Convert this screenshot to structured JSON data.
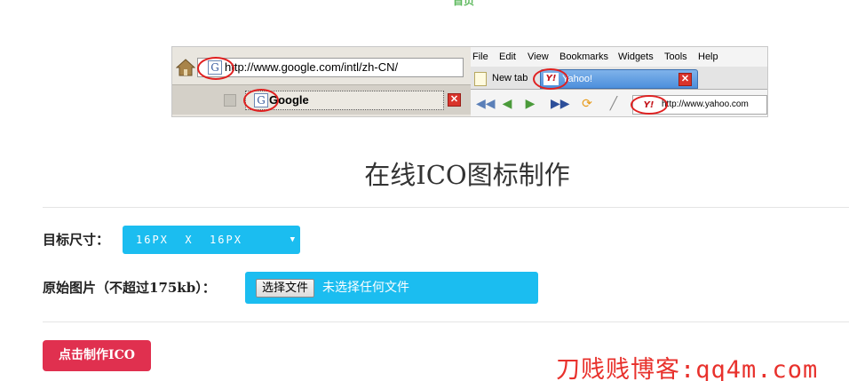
{
  "nav": {
    "home_label": "首页"
  },
  "banner": {
    "left_url": "http://www.google.com/intl/zh-CN/",
    "google_tab_title": "Google",
    "favicon_letter": "G",
    "close_glyph": "✕",
    "menu": [
      "File",
      "Edit",
      "View",
      "Bookmarks",
      "Widgets",
      "Tools",
      "Help"
    ],
    "new_tab_label": "New tab",
    "yahoo_tab_title": "Yahoo!",
    "yahoo_fav": "Y!",
    "yahoo_url": "http://www.yahoo.com",
    "highlight_color": "#e02020"
  },
  "page": {
    "title": "在线ICO图标制作"
  },
  "form": {
    "size_label": "目标尺寸：",
    "size_value": "16PX  X  16PX",
    "source_label": "原始图片（不超过175kb）：",
    "file_button": "选择文件",
    "file_status": "未选择任何文件",
    "submit_label": "点击制作ICO",
    "accent_color": "#1bbdf0",
    "submit_color": "#e0304f"
  },
  "watermark": {
    "text": "刀贱贱博客:qq4m.com"
  }
}
